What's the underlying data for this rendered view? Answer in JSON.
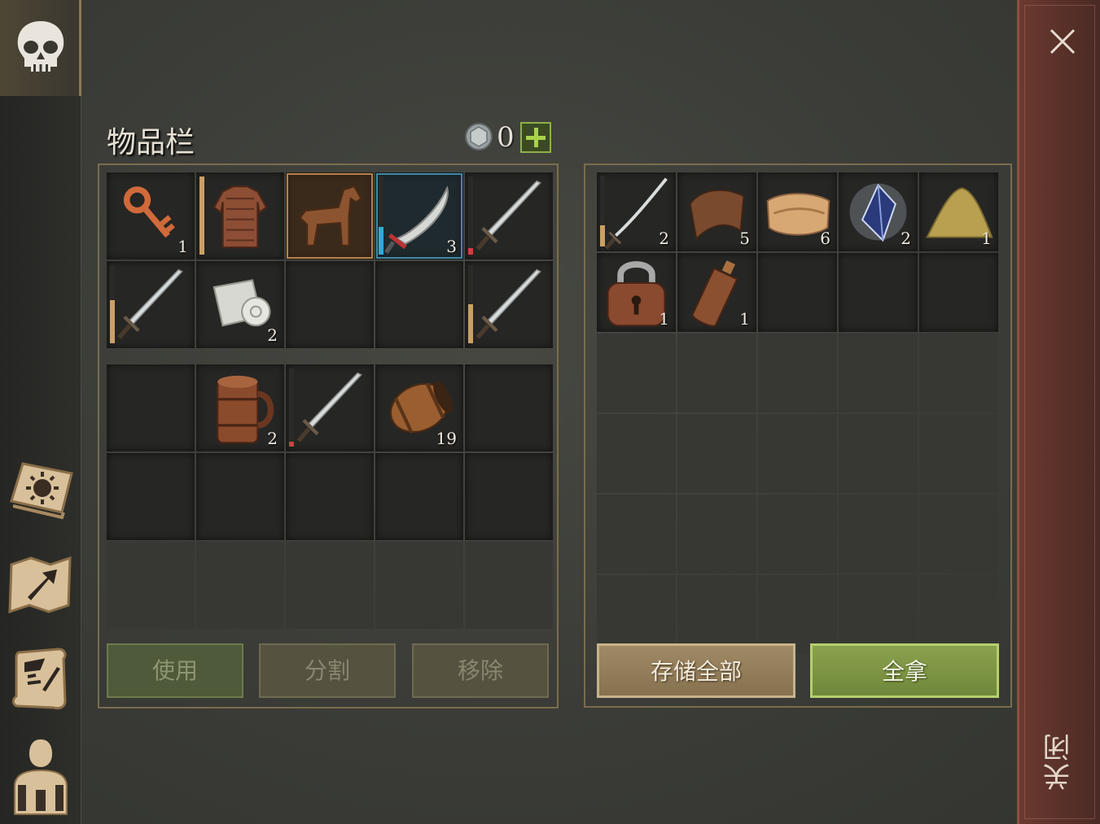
{
  "inventory": {
    "title": "物品栏",
    "coins": "0",
    "equipment_slots": [
      {
        "icon": "key-icon",
        "count": "1"
      },
      {
        "icon": "chainmail-armor-icon",
        "count": "",
        "durability": 1.0,
        "durability_color": "#c9a066"
      },
      {
        "icon": "wooden-horse-icon",
        "count": ""
      },
      {
        "icon": "scimitar-icon",
        "count": "3",
        "durability": 0.35,
        "durability_color": "#3aa8d0"
      },
      {
        "icon": "sword-icon",
        "count": "",
        "durability": 0.08,
        "durability_color": "#d04040"
      },
      {
        "icon": "sword-icon",
        "count": "",
        "durability": 0.55,
        "durability_color": "#c9a066"
      },
      {
        "icon": "cloth-roll-icon",
        "count": "2"
      },
      {
        "icon": "",
        "count": ""
      },
      {
        "icon": "",
        "count": ""
      },
      {
        "icon": "sword-icon",
        "count": "",
        "durability": 0.5,
        "durability_color": "#c9a066"
      }
    ],
    "bag_slots": [
      {
        "icon": "",
        "count": ""
      },
      {
        "icon": "wooden-mug-icon",
        "count": "2"
      },
      {
        "icon": "sword-icon",
        "count": "",
        "durability": 0.06,
        "durability_color": "#d04040"
      },
      {
        "icon": "barrel-icon",
        "count": "19"
      },
      {
        "icon": "",
        "count": ""
      },
      {
        "icon": "",
        "count": ""
      },
      {
        "icon": "",
        "count": ""
      },
      {
        "icon": "",
        "count": ""
      },
      {
        "icon": "",
        "count": ""
      },
      {
        "icon": "",
        "count": ""
      },
      {
        "icon": "",
        "count": "",
        "dim": true
      },
      {
        "icon": "",
        "count": "",
        "dim": true
      },
      {
        "icon": "",
        "count": "",
        "dim": true
      },
      {
        "icon": "",
        "count": "",
        "dim": true
      },
      {
        "icon": "",
        "count": "",
        "dim": true
      }
    ],
    "buttons": {
      "use": "使用",
      "split": "分割",
      "remove": "移除"
    }
  },
  "loot": {
    "slots": [
      {
        "icon": "katana-icon",
        "count": "2",
        "durability": 0.3,
        "durability_color": "#c9a066"
      },
      {
        "icon": "leather-icon",
        "count": "5"
      },
      {
        "icon": "fabric-icon",
        "count": "6"
      },
      {
        "icon": "crystal-icon",
        "count": "2"
      },
      {
        "icon": "sand-pile-icon",
        "count": "1"
      },
      {
        "icon": "padlock-icon",
        "count": "1"
      },
      {
        "icon": "leather-flask-icon",
        "count": "1"
      },
      {
        "icon": "",
        "count": ""
      },
      {
        "icon": "",
        "count": ""
      },
      {
        "icon": "",
        "count": ""
      },
      {
        "icon": "",
        "count": "",
        "dim": true
      },
      {
        "icon": "",
        "count": "",
        "dim": true
      },
      {
        "icon": "",
        "count": "",
        "dim": true
      },
      {
        "icon": "",
        "count": "",
        "dim": true
      },
      {
        "icon": "",
        "count": "",
        "dim": true
      },
      {
        "icon": "",
        "count": "",
        "dim": true
      },
      {
        "icon": "",
        "count": "",
        "dim": true
      },
      {
        "icon": "",
        "count": "",
        "dim": true
      },
      {
        "icon": "",
        "count": "",
        "dim": true
      },
      {
        "icon": "",
        "count": "",
        "dim": true
      },
      {
        "icon": "",
        "count": "",
        "dim": true
      },
      {
        "icon": "",
        "count": "",
        "dim": true
      },
      {
        "icon": "",
        "count": "",
        "dim": true
      },
      {
        "icon": "",
        "count": "",
        "dim": true
      },
      {
        "icon": "",
        "count": "",
        "dim": true
      },
      {
        "icon": "",
        "count": "",
        "dim": true
      },
      {
        "icon": "",
        "count": "",
        "dim": true
      },
      {
        "icon": "",
        "count": "",
        "dim": true
      },
      {
        "icon": "",
        "count": "",
        "dim": true
      },
      {
        "icon": "",
        "count": "",
        "dim": true
      }
    ],
    "buttons": {
      "store_all": "存储全部",
      "take_all": "全拿"
    }
  },
  "close_label": "关闭",
  "sidebar": {
    "items": [
      "skull-icon",
      "sun-book-icon",
      "map-arrow-icon",
      "quest-scroll-icon",
      "character-icon"
    ]
  }
}
